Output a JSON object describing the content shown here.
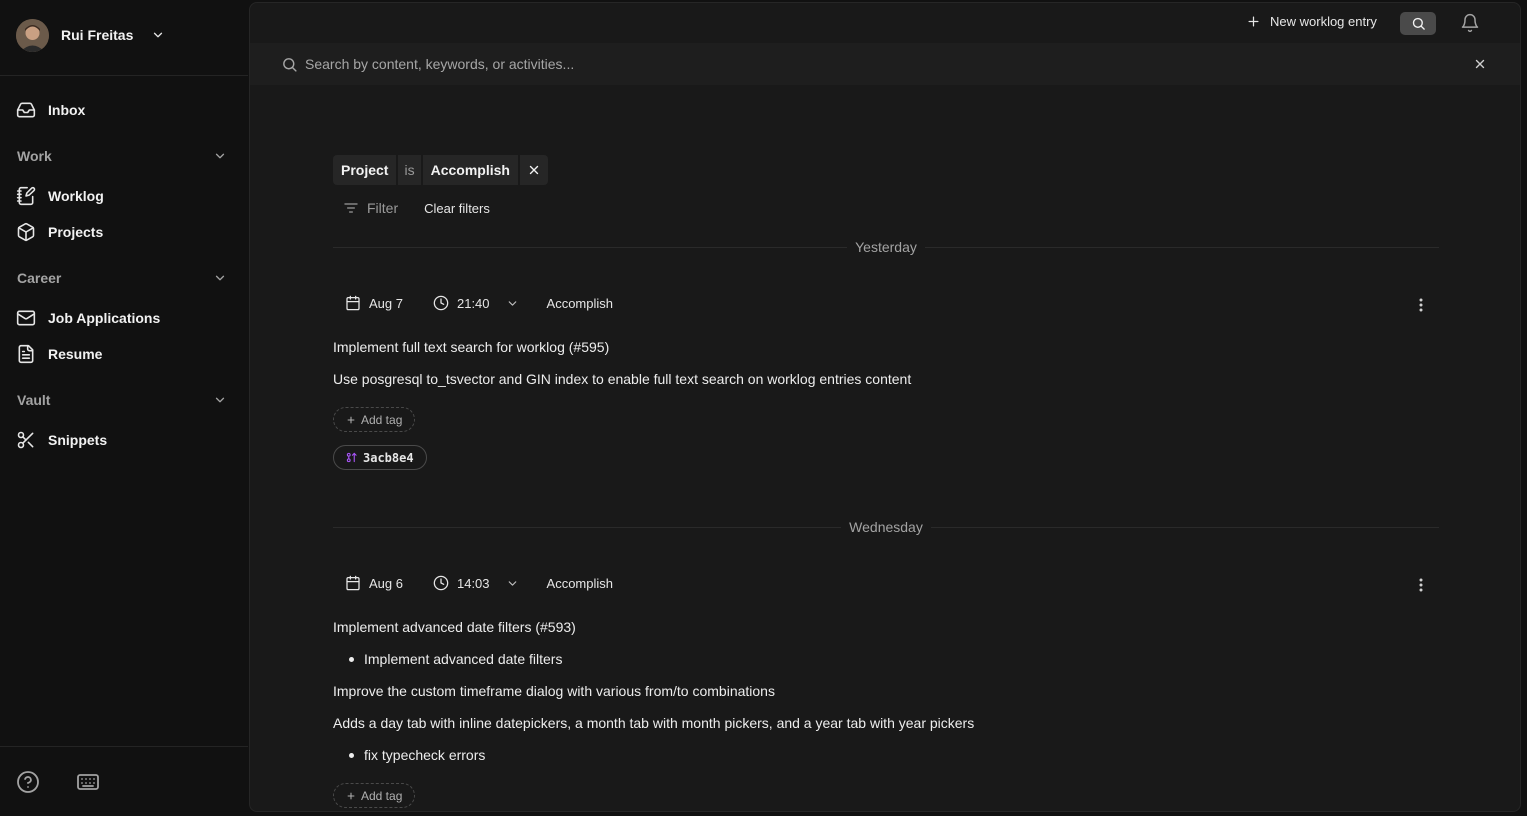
{
  "user": {
    "name": "Rui Freitas"
  },
  "nav": {
    "inbox": "Inbox",
    "sections": [
      {
        "label": "Work",
        "items": [
          "Worklog",
          "Projects"
        ]
      },
      {
        "label": "Career",
        "items": [
          "Job Applications",
          "Resume"
        ]
      },
      {
        "label": "Vault",
        "items": [
          "Snippets"
        ]
      }
    ]
  },
  "topbar": {
    "new_entry": "New worklog entry"
  },
  "search": {
    "placeholder": "Search by content, keywords, or activities..."
  },
  "filters": {
    "active": {
      "field": "Project",
      "operator": "is",
      "value": "Accomplish"
    },
    "filter_label": "Filter",
    "clear_label": "Clear filters"
  },
  "groups": [
    {
      "day": "Yesterday",
      "entries": [
        {
          "date": "Aug 7",
          "time": "21:40",
          "project": "Accomplish",
          "title": "Implement full text search for worklog (#595)",
          "body": [
            "Use posgresql to_tsvector and GIN index to enable full text search on worklog entries content"
          ],
          "add_tag": "Add tag",
          "commit": "3acb8e4"
        }
      ]
    },
    {
      "day": "Wednesday",
      "entries": [
        {
          "date": "Aug 6",
          "time": "14:03",
          "project": "Accomplish",
          "title": "Implement advanced date filters (#593)",
          "bullet1": "Implement advanced date filters",
          "line1": "Improve the custom timeframe dialog with various from/to combinations",
          "line2": "Adds a day tab with inline datepickers, a month tab with month pickers, and a year tab with year pickers",
          "bullet2": "fix typecheck errors",
          "add_tag": "Add tag"
        }
      ]
    }
  ],
  "colors": {
    "background": "#111111",
    "panel": "#191919",
    "commit_icon": "#a855f7"
  }
}
